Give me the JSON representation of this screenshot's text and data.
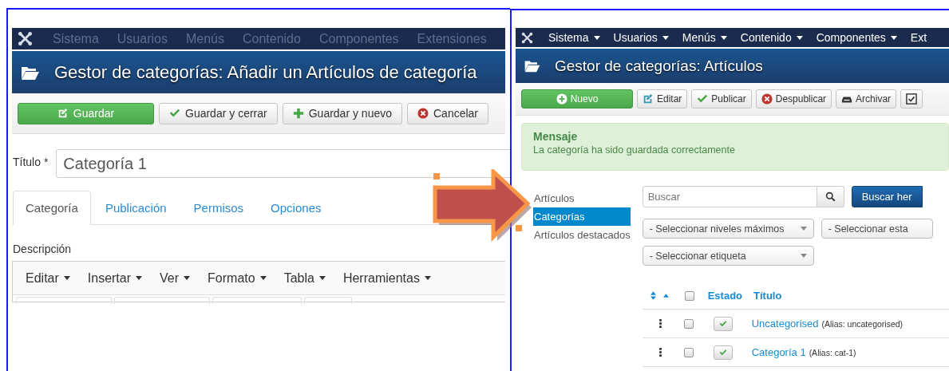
{
  "edit_screen": {
    "nav": [
      {
        "label": "Sistema",
        "disabled": true,
        "dropdown": false
      },
      {
        "label": "Usuarios",
        "disabled": true,
        "dropdown": false
      },
      {
        "label": "Menús",
        "disabled": true,
        "dropdown": false
      },
      {
        "label": "Contenido",
        "disabled": true,
        "dropdown": false
      },
      {
        "label": "Componentes",
        "disabled": true,
        "dropdown": false
      },
      {
        "label": "Extensiones",
        "disabled": true,
        "dropdown": false
      }
    ],
    "title": "Gestor de categorías: Añadir un Artículos de categoría",
    "toolbar": [
      {
        "label": "Guardar",
        "kind": "save"
      },
      {
        "label": "Guardar y cerrar",
        "kind": "check"
      },
      {
        "label": "Guardar y nuevo",
        "kind": "plus"
      },
      {
        "label": "Cancelar",
        "kind": "cancel"
      }
    ],
    "title_field": {
      "label": "Título *",
      "value": "Categoría 1"
    },
    "tabs": [
      {
        "label": "Categoría",
        "selected": true
      },
      {
        "label": "Publicación",
        "selected": false
      },
      {
        "label": "Permisos",
        "selected": false
      },
      {
        "label": "Opciones",
        "selected": false
      }
    ],
    "description_label": "Descripción",
    "editor_menu": [
      "Editar",
      "Insertar",
      "Ver",
      "Formato",
      "Tabla",
      "Herramientas"
    ]
  },
  "list_screen": {
    "nav": [
      {
        "label": "Sistema",
        "disabled": false,
        "dropdown": true
      },
      {
        "label": "Usuarios",
        "disabled": false,
        "dropdown": true
      },
      {
        "label": "Menús",
        "disabled": false,
        "dropdown": true
      },
      {
        "label": "Contenido",
        "disabled": false,
        "dropdown": true
      },
      {
        "label": "Componentes",
        "disabled": false,
        "dropdown": true
      },
      {
        "label": "Ext",
        "disabled": false,
        "dropdown": false
      }
    ],
    "title": "Gestor de categorías: Artículos",
    "toolbar": [
      {
        "label": "Nuevo",
        "kind": "new"
      },
      {
        "label": "Editar",
        "kind": "edit"
      },
      {
        "label": "Publicar",
        "kind": "check"
      },
      {
        "label": "Despublicar",
        "kind": "cancel"
      },
      {
        "label": "Archivar",
        "kind": "archive"
      },
      {
        "kind": "checkbox"
      }
    ],
    "message": {
      "title": "Mensaje",
      "text": "La categoría ha sido guardada correctamente"
    },
    "sidebar": [
      {
        "label": "Artículos",
        "selected": false
      },
      {
        "label": "Categorías",
        "selected": true
      },
      {
        "label": "Artículos destacados",
        "selected": false
      }
    ],
    "search": {
      "placeholder": "Buscar",
      "button": "Buscar her"
    },
    "filters": [
      "- Seleccionar niveles máximos",
      "- Seleccionar esta",
      "- Seleccionar etiqueta"
    ],
    "table": {
      "all_checked": false,
      "columns": [
        "Estado",
        "Título"
      ],
      "rows": [
        {
          "title": "Uncategorised",
          "alias": "(Alias: uncategorised)",
          "checked": false,
          "published": true
        },
        {
          "title": "Categoría 1",
          "alias": "(Alias: cat-1)",
          "checked": false,
          "published": true
        }
      ]
    }
  }
}
